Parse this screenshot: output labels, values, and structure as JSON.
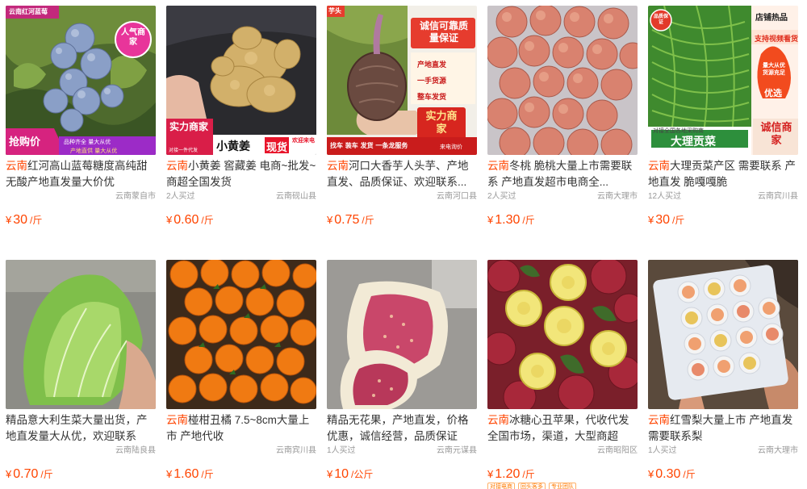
{
  "products": [
    {
      "title_region": "云南",
      "title_rest": "红河高山蓝莓糖度高纯甜无酸产地直发量大价优",
      "bought": "",
      "location": "云南蒙自市",
      "currency": "¥",
      "price": "30",
      "unit": "/斤",
      "image": "blueberries",
      "overlay": {
        "store": "云南红河蓝莓",
        "badge": "人气商家",
        "flash": "抢购价",
        "line1": "品种齐全 量大从优",
        "line2": "产地直供 量大从优"
      }
    },
    {
      "title_region": "云南",
      "title_rest": "小黄姜 窖藏姜 电商~批发~商超全国发货",
      "bought": "2人买过",
      "location": "云南砚山县",
      "currency": "¥",
      "price": "0.60",
      "unit": "/斤",
      "image": "ginger",
      "overlay": {
        "badge": "实力商家",
        "sub": "对接一件代发",
        "name": "小黄姜",
        "tag": "现货",
        "tag2": "欢迎来电"
      }
    },
    {
      "title_region": "云南",
      "title_rest": "河口大香芋人头芋、产地直发、品质保证、欢迎联系...",
      "bought": "",
      "location": "云南河口县",
      "currency": "¥",
      "price": "0.75",
      "unit": "/斤",
      "image": "taro",
      "overlay": {
        "corner": "芋头",
        "head": "诚信可靠质量保证",
        "list": [
          "产地直发",
          "一手货源",
          "整车发货"
        ],
        "badge": "实力商家",
        "bottom": "找车 装车 发货 一条龙服务",
        "phone": "来电询价"
      }
    },
    {
      "title_region": "云南",
      "title_rest": "冬桃 脆桃大量上市需要联系 产地直发超市电商全...",
      "bought": "2人买过",
      "location": "云南大理市",
      "currency": "¥",
      "price": "1.30",
      "unit": "/斤",
      "image": "peaches",
      "overlay": {}
    },
    {
      "title_region": "云南",
      "title_rest": "大理贡菜产区 需要联系 产地直发 脆嘎嘎脆",
      "bought": "12人买过",
      "location": "云南宾川县",
      "currency": "¥",
      "price": "30",
      "unit": "/斤",
      "image": "gongcai",
      "overlay": {
        "seal": "品质保证",
        "hot": "店铺热品",
        "video": "支持视频看货",
        "fire": "量大从优 货源充足",
        "fire2": "优选",
        "name": "大理贡菜",
        "small": "对接全国各地采购商",
        "badge": "诚信商家"
      }
    },
    {
      "title_region": "",
      "title_rest": "精品意大利生菜大量出货，产地直发量大从优，欢迎联系",
      "bought": "",
      "location": "云南陆良县",
      "currency": "¥",
      "price": "0.70",
      "unit": "/斤",
      "image": "lettuce",
      "overlay": {}
    },
    {
      "title_region": "云南",
      "title_rest": "椪柑丑橘 7.5~8cm大量上市 产地代收",
      "bought": "",
      "location": "云南宾川县",
      "currency": "¥",
      "price": "1.60",
      "unit": "/斤",
      "image": "mandarins",
      "overlay": {}
    },
    {
      "title_region": "",
      "title_rest": "精品无花果，产地直发，价格优惠，诚信经营，品质保证",
      "bought": "1人买过",
      "location": "云南元谋县",
      "currency": "¥",
      "price": "10",
      "unit": "/公斤",
      "image": "figs",
      "overlay": {}
    },
    {
      "title_region": "云南",
      "title_rest": "冰糖心丑苹果，代收代发全国市场，渠道，大型商超",
      "bought": "",
      "location": "云南昭阳区",
      "currency": "¥",
      "price": "1.20",
      "unit": "/斤",
      "image": "apples",
      "tags": [
        "对接电商",
        "回头客多",
        "专业团队"
      ],
      "overlay": {}
    },
    {
      "title_region": "云南",
      "title_rest": "红雪梨大量上市 产地直发 需要联系梨",
      "bought": "1人买过",
      "location": "云南大理市",
      "currency": "¥",
      "price": "0.30",
      "unit": "/斤",
      "image": "pears",
      "overlay": {}
    }
  ],
  "colors": {
    "price": "#ff4400",
    "region": "#ff4400",
    "meta": "#999999",
    "badge": "#e8162f"
  }
}
